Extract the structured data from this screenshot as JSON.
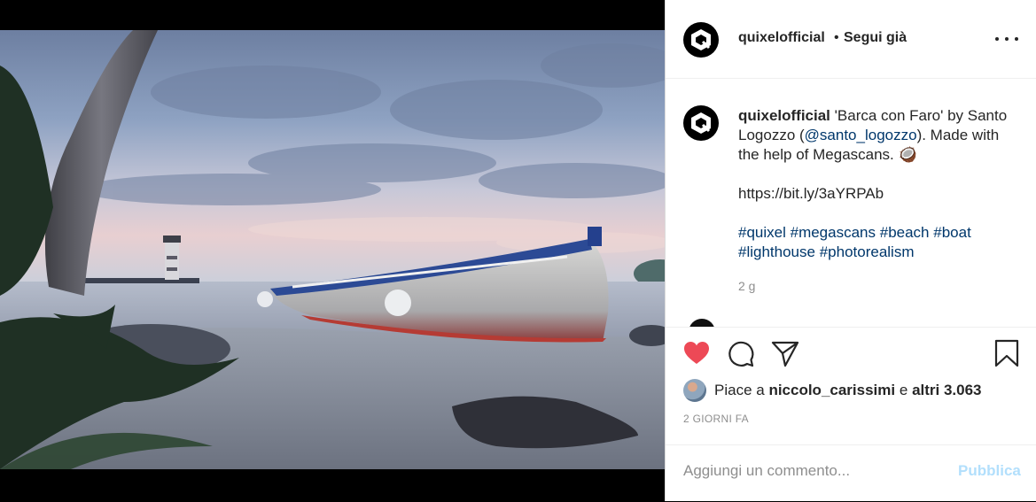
{
  "post": {
    "username": "quixelofficial",
    "separator": "•",
    "follow_status": "Segui già",
    "more_icon": "more-options-icon"
  },
  "caption": {
    "username": "quixelofficial",
    "text_1": "'Barca con Faro' by Santo Logozzo (",
    "mention": "@santo_logozzo",
    "text_2": "). Made with the help of Megascans.",
    "emoji": "🥥",
    "link": "https://bit.ly/3aYRPAb",
    "hashtags": [
      "#quixel",
      "#megascans",
      "#beach",
      "#boat",
      "#lighthouse",
      "#photorealism"
    ],
    "time_ago": "2 g"
  },
  "actions": {
    "like_icon": "heart-filled-icon",
    "comment_icon": "comment-icon",
    "share_icon": "share-icon",
    "save_icon": "bookmark-icon"
  },
  "likes": {
    "prefix": "Piace a",
    "user": "niccolo_carissimi",
    "conjunction": "e",
    "others": "altri 3.063"
  },
  "date_label": "2 GIORNI FA",
  "comment_box": {
    "placeholder": "Aggiungi un commento...",
    "publish_label": "Pubblica"
  },
  "colors": {
    "like_red": "#ed4956",
    "link_blue": "#00376b",
    "publish_disabled": "#b2dffc",
    "muted_gray": "#8e8e8e"
  }
}
